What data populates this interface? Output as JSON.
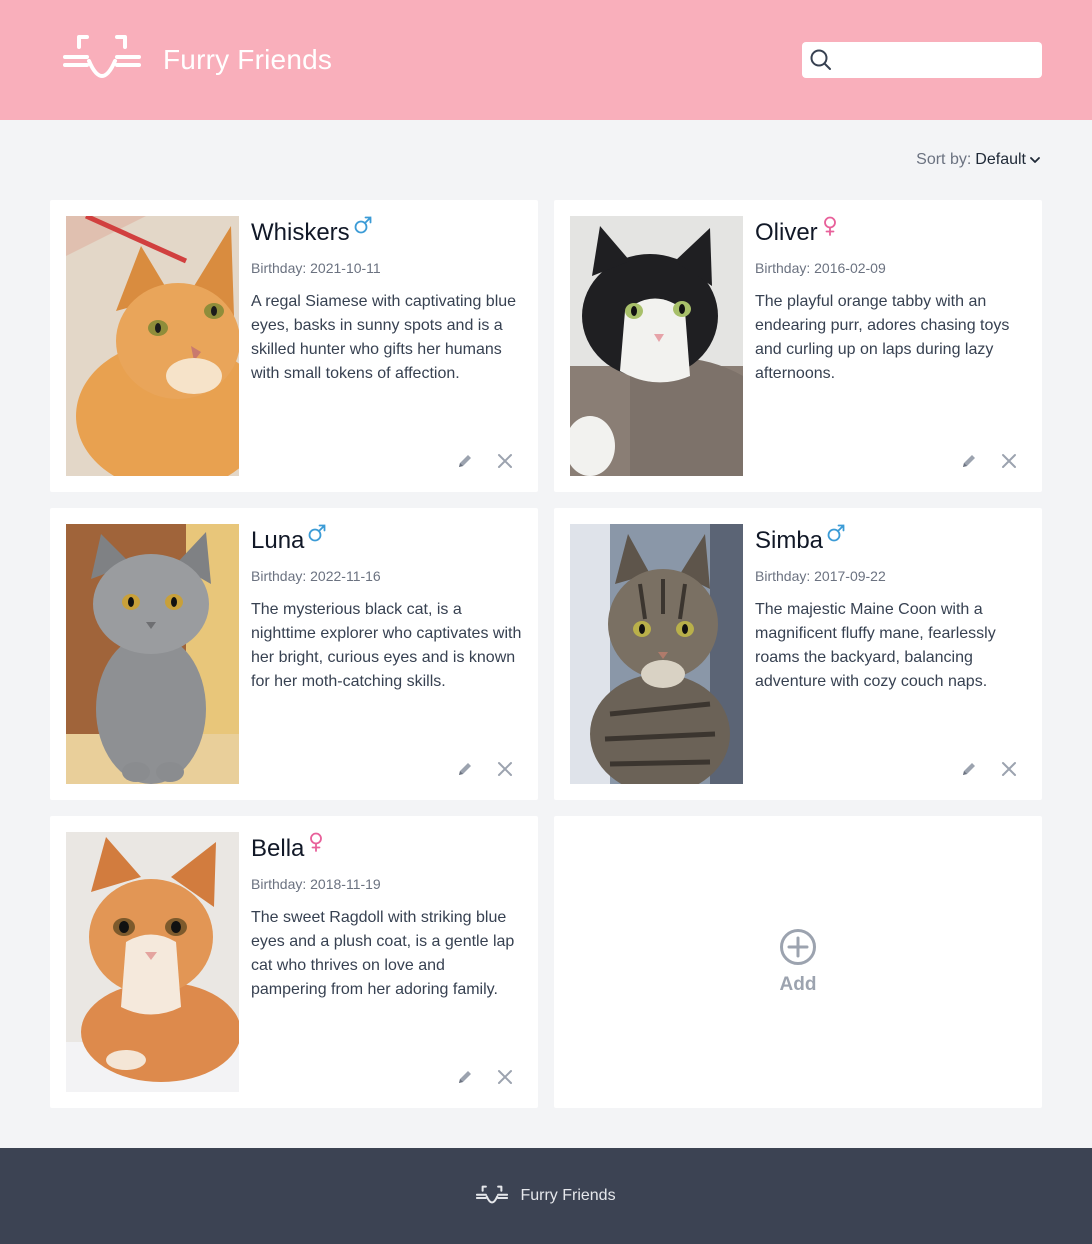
{
  "app": {
    "name": "Furry Friends",
    "accent_color": "#f9afbb",
    "footer_color": "#3c4353"
  },
  "search": {
    "placeholder": "",
    "value": "",
    "icon": "search-icon"
  },
  "sort": {
    "label": "Sort by:",
    "value": "Default"
  },
  "pets": [
    {
      "name": "Whiskers",
      "gender": "male",
      "birthday_label": "Birthday:",
      "birthday": "2021-10-11",
      "description": "A regal Siamese with captivating blue eyes, basks in sunny spots and is a skilled hunter who gifts her humans with small tokens of affection."
    },
    {
      "name": "Oliver",
      "gender": "female",
      "birthday_label": "Birthday:",
      "birthday": "2016-02-09",
      "description": "The playful orange tabby with an endearing purr, adores chasing toys and curling up on laps during lazy afternoons."
    },
    {
      "name": "Luna",
      "gender": "male",
      "birthday_label": "Birthday:",
      "birthday": "2022-11-16",
      "description": "The mysterious black cat, is a nighttime explorer who captivates with her bright, curious eyes and is known for her moth-catching skills."
    },
    {
      "name": "Simba",
      "gender": "male",
      "birthday_label": "Birthday:",
      "birthday": "2017-09-22",
      "description": "The majestic Maine Coon with a magnificent fluffy mane, fearlessly roams the backyard, balancing adventure with cozy couch naps."
    },
    {
      "name": "Bella",
      "gender": "female",
      "birthday_label": "Birthday:",
      "birthday": "2018-11-19",
      "description": "The sweet Ragdoll with striking blue eyes and a plush coat, is a gentle lap cat who thrives on love and pampering from her adoring family."
    }
  ],
  "add_card": {
    "label": "Add"
  },
  "colors": {
    "male": "#3b9bd6",
    "female": "#e8609a",
    "action_icon": "#9ca3af"
  }
}
